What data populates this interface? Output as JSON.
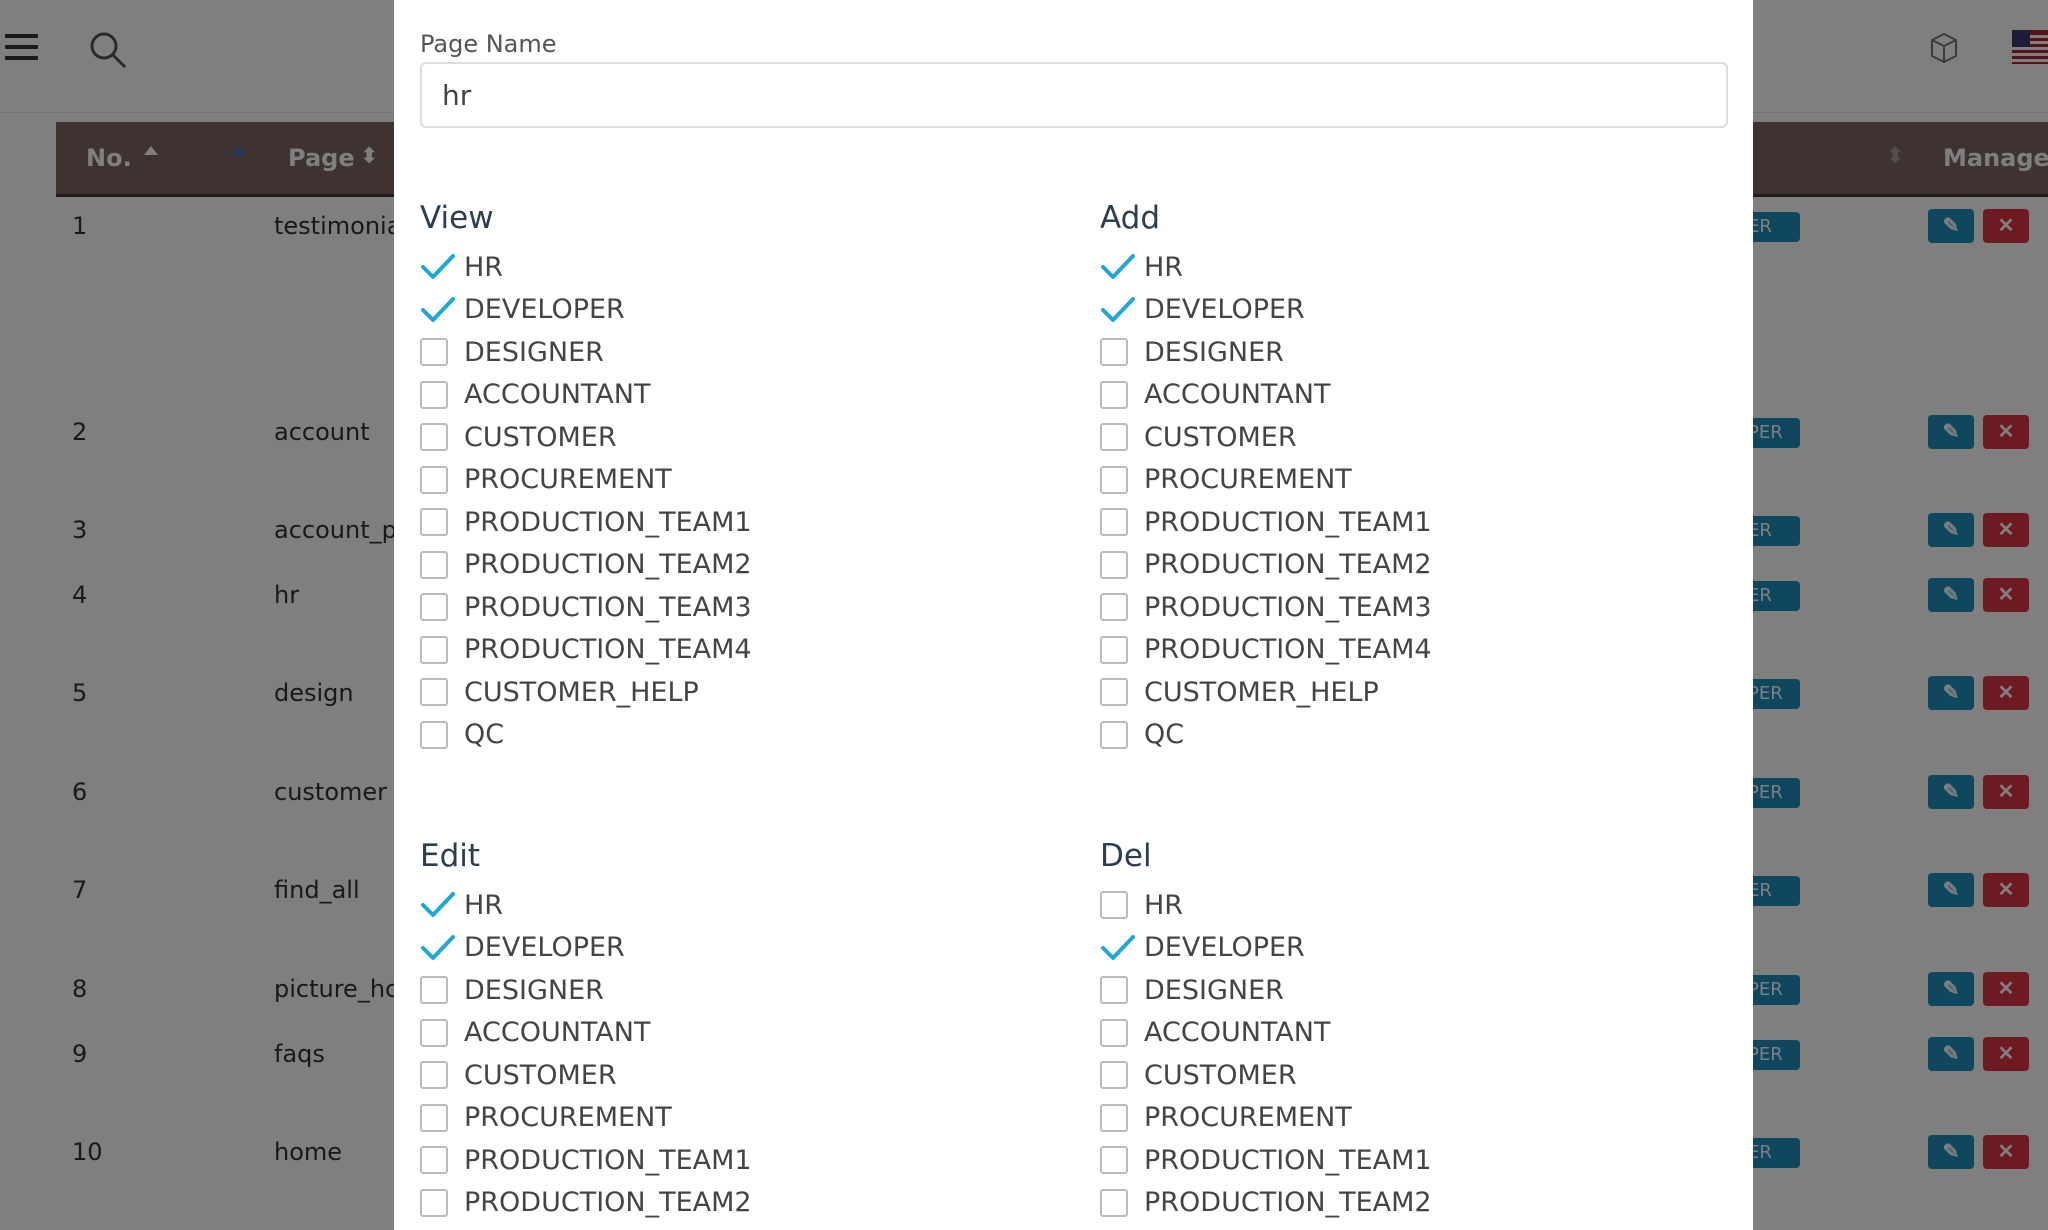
{
  "header": {
    "icons": [
      "hamburger-icon",
      "search-icon",
      "box-icon",
      "us-flag-icon"
    ]
  },
  "table": {
    "headers": {
      "no": "No.",
      "page": "Page",
      "manage": "Manage"
    },
    "rows": [
      {
        "no": "1",
        "page": "testimonia",
        "role": "ER"
      },
      {
        "no": "2",
        "page": "account",
        "role": "PER"
      },
      {
        "no": "3",
        "page": "account_p",
        "role": "ER"
      },
      {
        "no": "4",
        "page": "hr",
        "role": "ER"
      },
      {
        "no": "5",
        "page": "design",
        "role": "PER"
      },
      {
        "no": "6",
        "page": "customer",
        "role": "PER"
      },
      {
        "no": "7",
        "page": "find_all",
        "role": "ER"
      },
      {
        "no": "8",
        "page": "picture_hc",
        "role": "PER"
      },
      {
        "no": "9",
        "page": "faqs",
        "role": "PER"
      },
      {
        "no": "10",
        "page": "home",
        "role": "ER"
      }
    ]
  },
  "modal": {
    "page_name_label": "Page Name",
    "page_name_value": "hr",
    "groups": [
      {
        "title": "View",
        "options": [
          {
            "label": "HR",
            "checked": true
          },
          {
            "label": "DEVELOPER",
            "checked": true
          },
          {
            "label": "DESIGNER",
            "checked": false
          },
          {
            "label": "ACCOUNTANT",
            "checked": false
          },
          {
            "label": "CUSTOMER",
            "checked": false
          },
          {
            "label": "PROCUREMENT",
            "checked": false
          },
          {
            "label": "PRODUCTION_TEAM1",
            "checked": false
          },
          {
            "label": "PRODUCTION_TEAM2",
            "checked": false
          },
          {
            "label": "PRODUCTION_TEAM3",
            "checked": false
          },
          {
            "label": "PRODUCTION_TEAM4",
            "checked": false
          },
          {
            "label": "CUSTOMER_HELP",
            "checked": false
          },
          {
            "label": "QC",
            "checked": false
          }
        ]
      },
      {
        "title": "Add",
        "options": [
          {
            "label": "HR",
            "checked": true
          },
          {
            "label": "DEVELOPER",
            "checked": true
          },
          {
            "label": "DESIGNER",
            "checked": false
          },
          {
            "label": "ACCOUNTANT",
            "checked": false
          },
          {
            "label": "CUSTOMER",
            "checked": false
          },
          {
            "label": "PROCUREMENT",
            "checked": false
          },
          {
            "label": "PRODUCTION_TEAM1",
            "checked": false
          },
          {
            "label": "PRODUCTION_TEAM2",
            "checked": false
          },
          {
            "label": "PRODUCTION_TEAM3",
            "checked": false
          },
          {
            "label": "PRODUCTION_TEAM4",
            "checked": false
          },
          {
            "label": "CUSTOMER_HELP",
            "checked": false
          },
          {
            "label": "QC",
            "checked": false
          }
        ]
      },
      {
        "title": "Edit",
        "options": [
          {
            "label": "HR",
            "checked": true
          },
          {
            "label": "DEVELOPER",
            "checked": true
          },
          {
            "label": "DESIGNER",
            "checked": false
          },
          {
            "label": "ACCOUNTANT",
            "checked": false
          },
          {
            "label": "CUSTOMER",
            "checked": false
          },
          {
            "label": "PROCUREMENT",
            "checked": false
          },
          {
            "label": "PRODUCTION_TEAM1",
            "checked": false
          },
          {
            "label": "PRODUCTION_TEAM2",
            "checked": false
          }
        ]
      },
      {
        "title": "Del",
        "options": [
          {
            "label": "HR",
            "checked": false
          },
          {
            "label": "DEVELOPER",
            "checked": true
          },
          {
            "label": "DESIGNER",
            "checked": false
          },
          {
            "label": "ACCOUNTANT",
            "checked": false
          },
          {
            "label": "CUSTOMER",
            "checked": false
          },
          {
            "label": "PROCUREMENT",
            "checked": false
          },
          {
            "label": "PRODUCTION_TEAM1",
            "checked": false
          },
          {
            "label": "PRODUCTION_TEAM2",
            "checked": false
          }
        ]
      }
    ]
  },
  "colors": {
    "accent": "#1fa8d6",
    "table_header": "#7d6763",
    "edit_button": "#1f8fbf",
    "delete_button": "#dc3545"
  }
}
